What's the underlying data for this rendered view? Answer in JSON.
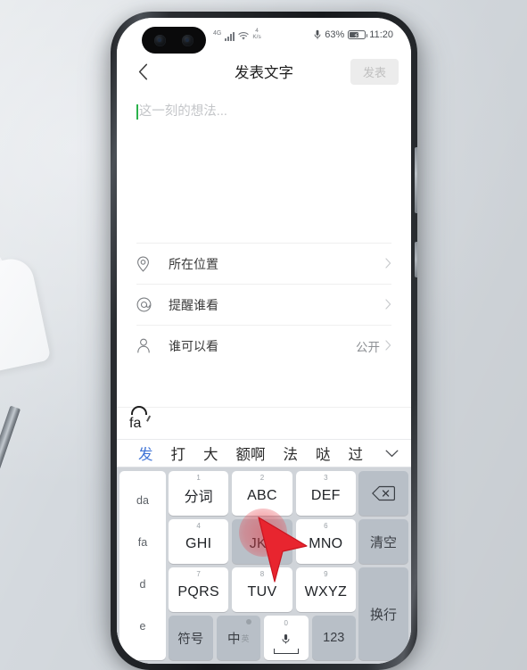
{
  "status_bar": {
    "signal_prefix": "4G",
    "net_speed_value": "4",
    "net_speed_unit": "K/s",
    "mic_icon": "microphone-icon",
    "battery_percent": "63%",
    "battery_level": 63,
    "time": "11:20"
  },
  "nav": {
    "back_icon": "chevron-left-icon",
    "title": "发表文字",
    "send_label": "发表"
  },
  "editor": {
    "placeholder": "这一刻的想法..."
  },
  "options": [
    {
      "icon": "location-pin-icon",
      "label": "所在位置",
      "value": "",
      "chevron": "›"
    },
    {
      "icon": "at-sign-icon",
      "label": "提醒谁看",
      "value": "",
      "chevron": "›"
    },
    {
      "icon": "person-icon",
      "label": "谁可以看",
      "value": "公开",
      "chevron": "›"
    }
  ],
  "ime": {
    "composing": "fa",
    "candidates": [
      {
        "text": "发",
        "selected": true
      },
      {
        "text": "打",
        "selected": false
      },
      {
        "text": "大",
        "selected": false
      },
      {
        "text": "额啊",
        "selected": false
      },
      {
        "text": "法",
        "selected": false
      },
      {
        "text": "哒",
        "selected": false
      },
      {
        "text": "过",
        "selected": false
      }
    ],
    "expand_icon": "chevron-down-icon",
    "pinyin_options": [
      "da",
      "fa",
      "d",
      "e"
    ],
    "keys": {
      "k1_num": "1",
      "k1_label": "分词",
      "k2_num": "2",
      "k2_label": "ABC",
      "k3_num": "3",
      "k3_label": "DEF",
      "k4_num": "4",
      "k4_label": "GHI",
      "k5_num": "5",
      "k5_label": "JKL",
      "k6_num": "6",
      "k6_label": "MNO",
      "k7_num": "7",
      "k7_label": "PQRS",
      "k8_num": "8",
      "k8_label": "TUV",
      "k9_num": "9",
      "k9_label": "WXYZ",
      "backspace_icon": "backspace-icon",
      "clear_label": "清空",
      "newline_label": "换行",
      "symbol_label": "符号",
      "lang_label": "中",
      "lang_sub": "英",
      "space_num": "0",
      "space_icon": "microphone-icon",
      "num_label": "123"
    }
  },
  "colors": {
    "accent_green": "#2bb24c",
    "candidate_selected": "#3f74d6",
    "keyboard_bg": "#d0d4d9",
    "key_gray": "#b8bfc7",
    "tap_indicator": "#e43e48"
  }
}
